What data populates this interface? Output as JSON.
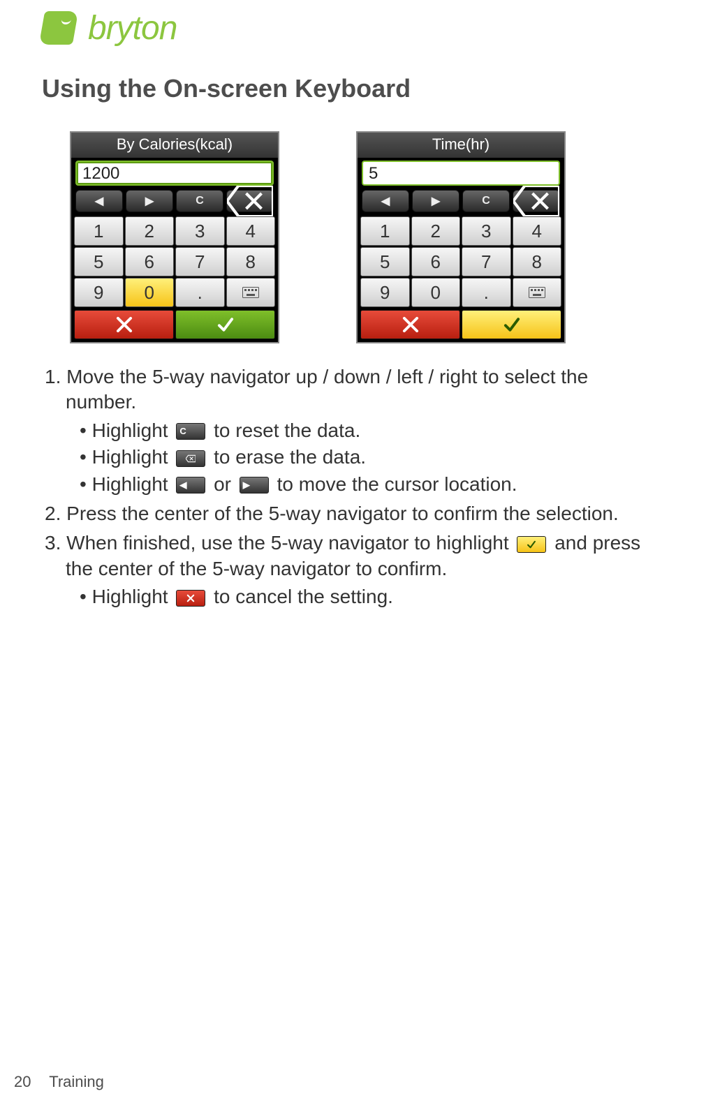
{
  "brand": "bryton",
  "title": "Using the On-screen Keyboard",
  "screens": [
    {
      "label": "By Calories(kcal)",
      "value": "1200",
      "highlight_key": "0",
      "highlight_ok": false
    },
    {
      "label": "Time(hr)",
      "value": "5",
      "highlight_key": null,
      "highlight_ok": true
    }
  ],
  "keys": [
    "1",
    "2",
    "3",
    "4",
    "5",
    "6",
    "7",
    "8",
    "9",
    "0",
    ".",
    "kb"
  ],
  "toolbar_glyphs": {
    "left": "◀",
    "right": "▶",
    "clear": "C",
    "back": "⌫"
  },
  "steps": {
    "s1_num": "1.",
    "s1": "Move the 5-way navigator up / down / left / right to select the number.",
    "s1a_pre": "Highlight",
    "s1a_post": "to reset the data.",
    "s1b_pre": "Highlight",
    "s1b_post": "to erase the data.",
    "s1c_pre": "Highlight",
    "s1c_mid": "or",
    "s1c_post": "to move the cursor location.",
    "s2_num": "2.",
    "s2": "Press the center of the 5-way navigator to confirm the selection.",
    "s3_num": "3.",
    "s3_pre": "When finished, use the 5-way navigator to highlight",
    "s3_post": "and press the center of the 5-way navigator to confirm.",
    "s3a_pre": "Highlight",
    "s3a_post": "to cancel the setting."
  },
  "bullet": "•",
  "footer": {
    "page": "20",
    "section": "Training"
  }
}
